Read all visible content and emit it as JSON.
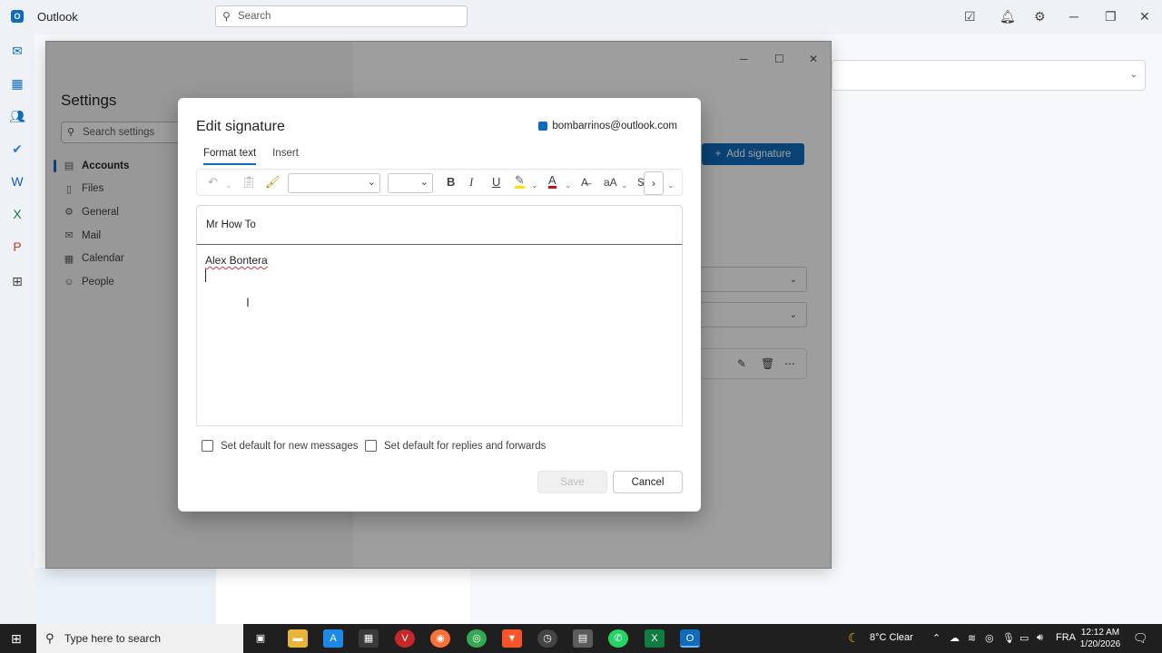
{
  "outlook": {
    "app_title": "Outlook",
    "search_placeholder": "Search"
  },
  "settings": {
    "title": "Settings",
    "search_placeholder": "Search settings",
    "nav": [
      {
        "label": "Accounts",
        "icon": "accounts-icon",
        "active": true
      },
      {
        "label": "Files",
        "icon": "file-icon"
      },
      {
        "label": "General",
        "icon": "gear-icon"
      },
      {
        "label": "Mail",
        "icon": "mail-icon"
      },
      {
        "label": "Calendar",
        "icon": "calendar-icon"
      },
      {
        "label": "People",
        "icon": "people-icon"
      }
    ],
    "add_signature_label": "Add signature"
  },
  "dialog": {
    "title": "Edit signature",
    "account_email": "bombarrinos@outlook.com",
    "tabs": [
      "Format text",
      "Insert"
    ],
    "signature_name": "Mr How To",
    "signature_text": "Alex Bontera",
    "checkbox_new": "Set default for new messages",
    "checkbox_replies": "Set default for replies and forwards",
    "save_label": "Save",
    "cancel_label": "Cancel"
  },
  "taskbar": {
    "search_placeholder": "Type here to search",
    "weather": "8°C  Clear",
    "language": "FRA",
    "time": "12:12 AM",
    "date": "1/20/2026"
  },
  "colors": {
    "accent": "#0f6cbd",
    "taskbar": "#1f1f1f"
  }
}
